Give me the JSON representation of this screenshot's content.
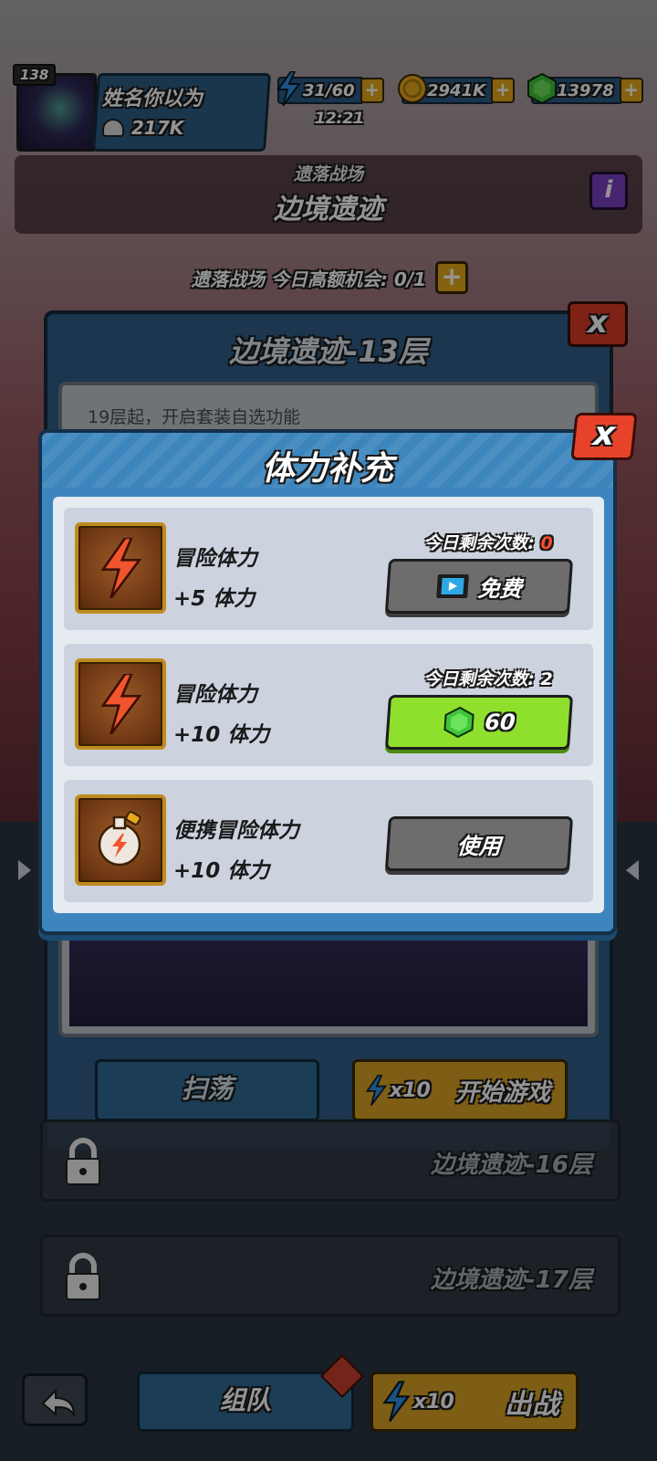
{
  "player": {
    "level": "138",
    "name": "姓名你以为",
    "power": "217K"
  },
  "resources": {
    "energy": "31/60",
    "energy_timer": "12:21",
    "gold": "2941K",
    "gems": "13978",
    "plus": "+"
  },
  "banner": {
    "subtitle": "遗落战场",
    "title": "边境遗迹",
    "info_label": "i"
  },
  "daily_chance": {
    "label": "遗落战场 今日高额机会: 0/1",
    "plus": "+"
  },
  "floor_panel": {
    "title": "边境遗迹-13层",
    "close_label": "x",
    "note": "19层起，开启套装自选功能",
    "sweep_label": "扫荡",
    "start_cost": "x10",
    "start_label": "开始游戏"
  },
  "locked_floors": [
    {
      "name": "边境遗迹-16层"
    },
    {
      "name": "边境遗迹-17层"
    }
  ],
  "bottom_nav": {
    "team_label": "组队",
    "battle_cost": "x10",
    "battle_label": "出战"
  },
  "modal": {
    "title": "体力补充",
    "close_label": "x",
    "items": [
      {
        "name": "冒险体力",
        "amount": "+5 体力",
        "remaining_label": "今日剩余次数:",
        "remaining_value": "0",
        "button_label": "免费",
        "icon": "lightning-icon"
      },
      {
        "name": "冒险体力",
        "amount": "+10 体力",
        "remaining_label": "今日剩余次数:",
        "remaining_value": "2",
        "button_label": "60",
        "icon": "lightning-icon"
      },
      {
        "name": "便携冒险体力",
        "amount": "+10 体力",
        "button_label": "使用",
        "icon": "potion-icon"
      }
    ]
  },
  "colors": {
    "energy": "#2f8fe0",
    "gold": "#e6a91d",
    "gem": "#3ec43a",
    "accent_red": "#e6432a",
    "green_button": "#8ee02c"
  }
}
